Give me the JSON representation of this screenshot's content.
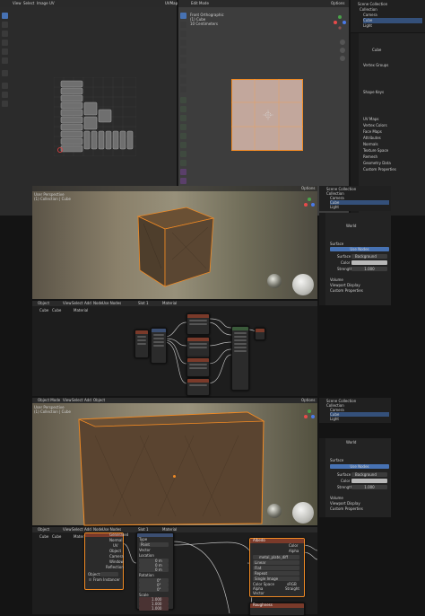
{
  "app": {
    "uv_editor": {
      "menus": [
        "View",
        "Select",
        "Image",
        "UV"
      ],
      "image_selector": "UVMap"
    },
    "viewport_top": {
      "info_lines": [
        "Front Orthographic",
        "(1) Cube",
        "10 Centimeters"
      ],
      "menus": [
        "Edit Mode",
        "View",
        "Select",
        "Add",
        "Mesh",
        "Vertex",
        "Edge",
        "Face",
        "UV"
      ],
      "shading_label": "Options"
    },
    "outliner": {
      "title": "Scene Collection",
      "items": [
        {
          "label": "Collection",
          "depth": 1,
          "selected": false
        },
        {
          "label": "Camera",
          "depth": 2,
          "selected": false
        },
        {
          "label": "Cube",
          "depth": 2,
          "selected": true
        },
        {
          "label": "Light",
          "depth": 2,
          "selected": false
        }
      ]
    },
    "properties_top": {
      "object_name": "Cube",
      "section_labels": [
        "Vertex Groups",
        "Shape Keys",
        "UV Maps",
        "Vertex Colors",
        "Face Maps",
        "Attributes",
        "Normals",
        "Texture Space",
        "Remesh",
        "Geometry Data",
        "Custom Properties"
      ]
    },
    "viewport_mid": {
      "info_lines": [
        "User Perspective",
        "(1) Collection | Cube"
      ],
      "shading_label": "Options"
    },
    "shader_mid": {
      "menus": [
        "Object",
        "View",
        "Select",
        "Add",
        "Node",
        "Use Nodes"
      ],
      "slot": "Slot 1",
      "material": "Material",
      "breadcrumb": [
        "Cube",
        "Cube",
        "Material"
      ]
    },
    "props_mid": {
      "world": "World",
      "section_surface": "Surface",
      "use_nodes": "Use Nodes",
      "surface_label": "Surface",
      "surface_value": "Background",
      "color_label": "Color",
      "strength_label": "Strength",
      "strength_value": "1.000",
      "sections_after": [
        "Volume",
        "Viewport Display",
        "Custom Properties"
      ]
    },
    "viewport_bot": {
      "info_lines": [
        "User Perspective",
        "(1) Collection | Cube"
      ],
      "menus": [
        "Object Mode",
        "View",
        "Select",
        "Add",
        "Object"
      ],
      "shading_label": "Options"
    },
    "shader_bot": {
      "menus": [
        "Object",
        "View",
        "Select",
        "Add",
        "Node",
        "Use Nodes"
      ],
      "slot": "Slot 1",
      "material": "Material",
      "breadcrumb": [
        "Cube",
        "Cube",
        "Material"
      ],
      "texcoord_outputs": [
        "Generated",
        "Normal",
        "UV",
        "Object",
        "Camera",
        "Window",
        "Reflection"
      ],
      "object_label": "Object:",
      "from_instancer": "From Instancer",
      "mapping_fields": [
        "Type",
        "Point",
        "Vector",
        "Location",
        "Rotation",
        "Scale"
      ],
      "mapping_type": "Point",
      "mapping_location": [
        "0 m",
        "0 m",
        "0 m"
      ],
      "mapping_rotation": [
        "0°",
        "0°",
        "0°"
      ],
      "mapping_scale": [
        "1.000",
        "1.000",
        "1.000"
      ],
      "image_node_title": "Albedo",
      "image_name": "metal_plate_diff",
      "image_fields": [
        "Linear",
        "Flat",
        "Repeat",
        "Single Image",
        "Color Space",
        "Alpha"
      ],
      "color_space": "sRGB",
      "alpha": "Straight",
      "outputs": [
        "Color",
        "Alpha"
      ],
      "vector_label": "Vector",
      "bottom_node_title": "Roughness"
    },
    "props_bot": {
      "world": "World",
      "section_surface": "Surface",
      "use_nodes": "Use Nodes",
      "surface_label": "Surface",
      "surface_value": "Background",
      "color_label": "Color",
      "strength_label": "Strength",
      "strength_value": "1.000",
      "sections_after": [
        "Volume",
        "Viewport Display",
        "Custom Properties"
      ]
    },
    "colors": {
      "accent_blue": "#4772b3",
      "selection_orange": "#f08a24",
      "node_header_red": "#7a3a2a",
      "node_header_purple": "#5a3a6a",
      "node_header_blue": "#3c4f72",
      "node_header_green": "#3a5a3a"
    }
  }
}
